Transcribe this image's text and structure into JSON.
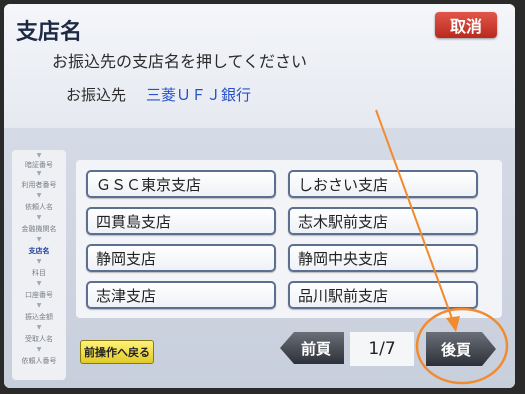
{
  "header": {
    "title": "支店名",
    "cancel_label": "取消",
    "instruction": "お振込先の支店名を押してください",
    "dest_label": "お振込先",
    "dest_value": "三菱ＵＦＪ銀行"
  },
  "steps": [
    {
      "label": "暗証番号",
      "active": false
    },
    {
      "label": "利用者番号",
      "active": false
    },
    {
      "label": "依頼人名",
      "active": false
    },
    {
      "label": "金融機関名",
      "active": false
    },
    {
      "label": "支店名",
      "active": true
    },
    {
      "label": "科目",
      "active": false
    },
    {
      "label": "口座番号",
      "active": false
    },
    {
      "label": "振込金額",
      "active": false
    },
    {
      "label": "受取人名",
      "active": false
    },
    {
      "label": "依頼人番号",
      "active": false
    }
  ],
  "branches": [
    {
      "label": "ＧＳＣ東京支店"
    },
    {
      "label": "しおさい支店"
    },
    {
      "label": "四貫島支店"
    },
    {
      "label": "志木駅前支店"
    },
    {
      "label": "静岡支店"
    },
    {
      "label": "静岡中央支店"
    },
    {
      "label": "志津支店"
    },
    {
      "label": "品川駅前支店"
    }
  ],
  "footer": {
    "back_label": "前操作へ戻る",
    "prev_label": "前頁",
    "page_indicator": "1/7",
    "next_label": "後頁"
  },
  "colors": {
    "annotation": "#f28a2e",
    "accent_blue": "#2853c8",
    "cancel_red": "#c8342a"
  }
}
